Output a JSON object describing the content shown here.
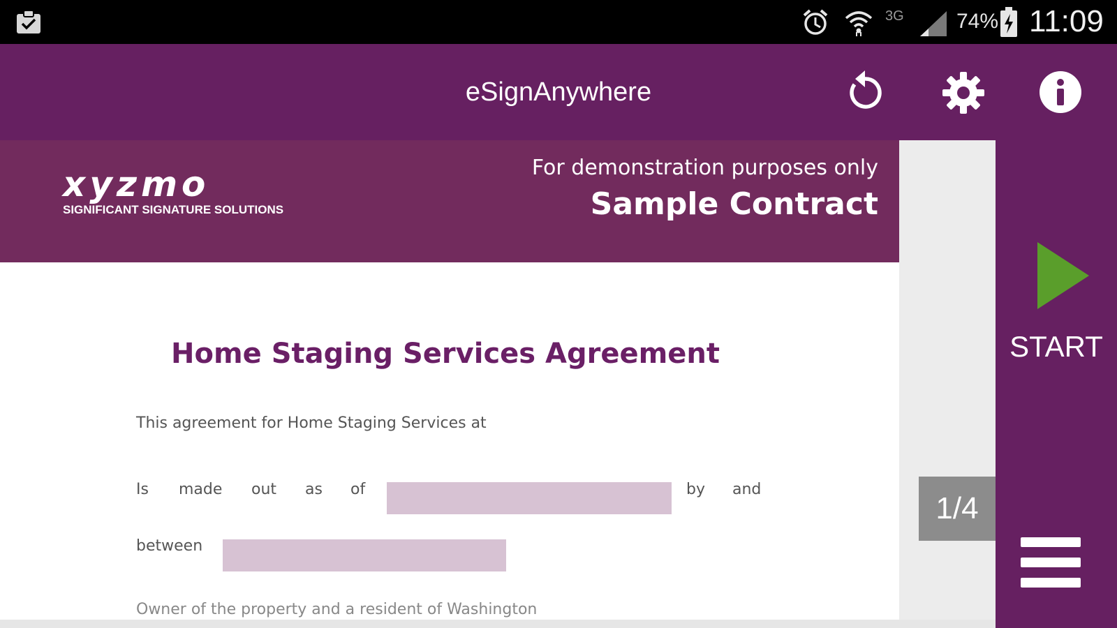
{
  "status_bar": {
    "network": "3G",
    "battery": "74%",
    "time": "11:09"
  },
  "app_bar": {
    "title": "eSignAnywhere",
    "icons": [
      "refresh-icon",
      "gear-icon",
      "info-icon"
    ]
  },
  "document": {
    "header": {
      "logo_wordmark": "xyzmo",
      "logo_tagline": "SIGNIFICANT SIGNATURE SOLUTIONS",
      "demo_note": "For demonstration purposes only",
      "doc_title": "Sample Contract"
    },
    "agreement_title": "Home Staging Services Agreement",
    "line1": "This agreement for Home Staging Services at",
    "line2_words": [
      "Is",
      "made",
      "out",
      "as",
      "of"
    ],
    "line2_after": [
      "by",
      "and"
    ],
    "line3_word": "between",
    "line4_partial": "Owner of the property and a resident of Washington"
  },
  "page_indicator": "1/4",
  "start_label": "START",
  "colors": {
    "app_bar": "#662061",
    "doc_header": "#722b5d",
    "title_text": "#6a1f66",
    "field_fill": "#d7c2d3",
    "play_green": "#5a9e2b",
    "page_indicator_bg": "#8c8c8c"
  }
}
